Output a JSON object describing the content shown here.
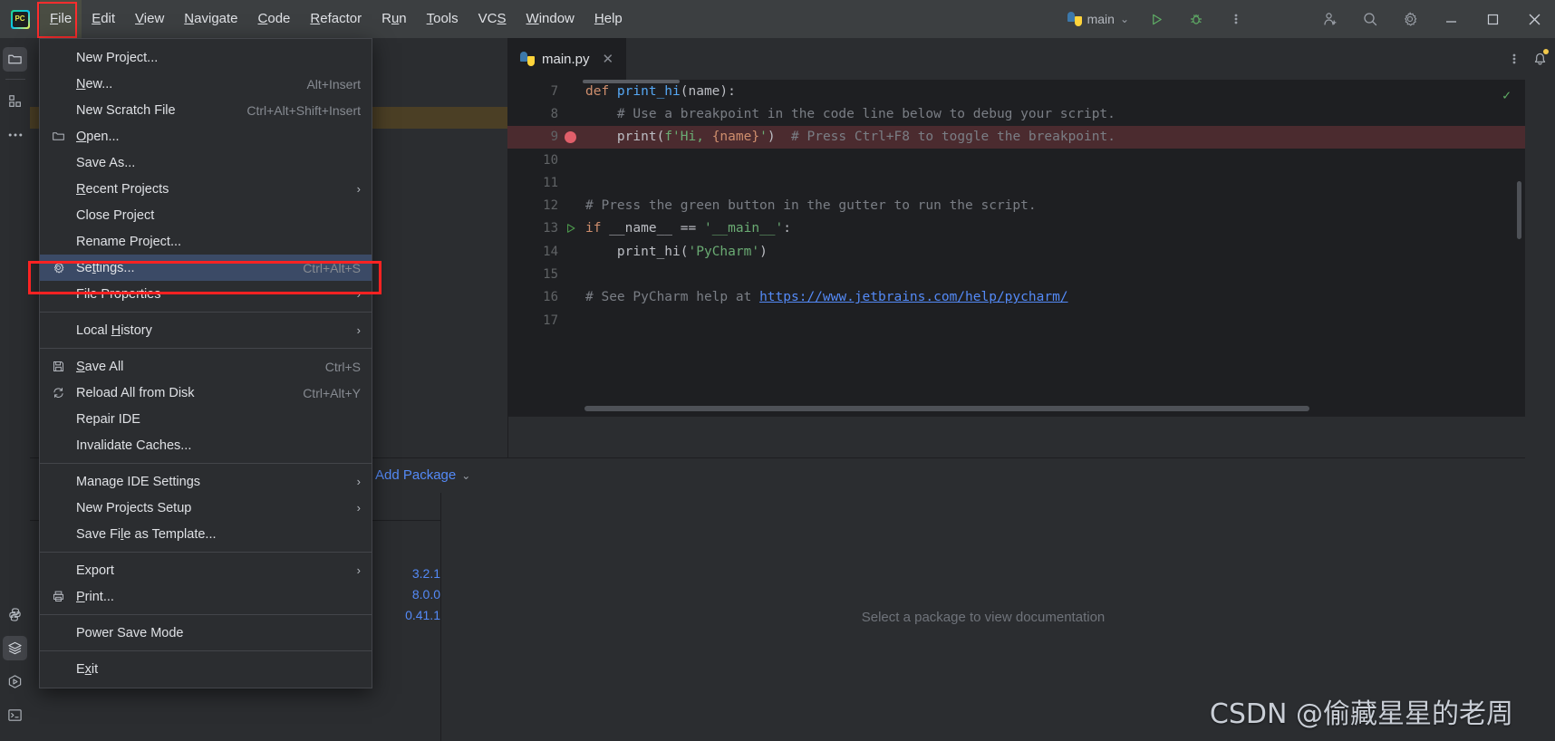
{
  "app": {
    "logo_text": "PC",
    "title": "PyCharm"
  },
  "menubar": {
    "items": [
      {
        "label": "File",
        "mnemonic": "F",
        "active": true
      },
      {
        "label": "Edit",
        "mnemonic": "E",
        "active": false
      },
      {
        "label": "View",
        "mnemonic": "V",
        "active": false
      },
      {
        "label": "Navigate",
        "mnemonic": "N",
        "active": false
      },
      {
        "label": "Code",
        "mnemonic": "C",
        "active": false
      },
      {
        "label": "Refactor",
        "mnemonic": "R",
        "active": false
      },
      {
        "label": "Run",
        "mnemonic": "u",
        "active": false
      },
      {
        "label": "Tools",
        "mnemonic": "T",
        "active": false
      },
      {
        "label": "VCS",
        "mnemonic": "S",
        "active": false
      },
      {
        "label": "Window",
        "mnemonic": "W",
        "active": false
      },
      {
        "label": "Help",
        "mnemonic": "H",
        "active": false
      }
    ]
  },
  "toolbar": {
    "run_config_label": "main",
    "run_icon": "run-triangle-icon",
    "debug_icon": "debug-bug-icon",
    "more_icon": "more-vertical-icon",
    "account_icon": "add-user-icon",
    "search_icon": "search-icon",
    "settings_icon": "gear-icon",
    "minimize_icon": "minimize-icon",
    "maximize_icon": "maximize-icon",
    "close_icon": "close-icon"
  },
  "left_strip": {
    "items": [
      {
        "name": "project-tool-window",
        "icon": "folder-icon",
        "selected": true
      },
      {
        "name": "structure-tool-window",
        "icon": "structure-icon",
        "selected": false
      },
      {
        "name": "more-tool-windows",
        "icon": "ellipsis-icon",
        "selected": false
      }
    ],
    "bottom_items": [
      {
        "name": "python-console",
        "icon": "python-icon",
        "selected": false
      },
      {
        "name": "python-packages",
        "icon": "layers-icon",
        "selected": true
      },
      {
        "name": "services",
        "icon": "services-play-icon",
        "selected": false
      },
      {
        "name": "terminal",
        "icon": "terminal-icon",
        "selected": false
      }
    ]
  },
  "right_strip": {
    "items": [
      {
        "name": "notifications",
        "icon": "bell-icon"
      }
    ]
  },
  "file_menu": {
    "groups": [
      [
        {
          "label": "New Project...",
          "shortcut": "",
          "icon": "",
          "submenu": false,
          "selected": false
        },
        {
          "label": "New...",
          "mnemonic": "N",
          "shortcut": "Alt+Insert",
          "icon": "",
          "submenu": false,
          "selected": false
        },
        {
          "label": "New Scratch File",
          "shortcut": "Ctrl+Alt+Shift+Insert",
          "icon": "",
          "submenu": false,
          "selected": false
        },
        {
          "label": "Open...",
          "mnemonic": "O",
          "shortcut": "",
          "icon": "folder-icon",
          "submenu": false,
          "selected": false
        },
        {
          "label": "Save As...",
          "shortcut": "",
          "icon": "",
          "submenu": false,
          "selected": false
        },
        {
          "label": "Recent Projects",
          "mnemonic": "R",
          "shortcut": "",
          "icon": "",
          "submenu": true,
          "selected": false
        },
        {
          "label": "Close Project",
          "shortcut": "",
          "icon": "",
          "submenu": false,
          "selected": false
        },
        {
          "label": "Rename Project...",
          "shortcut": "",
          "icon": "",
          "submenu": false,
          "selected": false
        },
        {
          "label": "Settings...",
          "mnemonic": "t",
          "shortcut": "Ctrl+Alt+S",
          "icon": "gear-icon",
          "submenu": false,
          "selected": true
        },
        {
          "label": "File Properties",
          "shortcut": "",
          "icon": "",
          "submenu": true,
          "selected": false
        }
      ],
      [
        {
          "label": "Local History",
          "mnemonic": "H",
          "shortcut": "",
          "icon": "",
          "submenu": true,
          "selected": false
        }
      ],
      [
        {
          "label": "Save All",
          "mnemonic": "S",
          "shortcut": "Ctrl+S",
          "icon": "save-disk-icon",
          "submenu": false,
          "selected": false
        },
        {
          "label": "Reload All from Disk",
          "shortcut": "Ctrl+Alt+Y",
          "icon": "refresh-icon",
          "submenu": false,
          "selected": false
        },
        {
          "label": "Repair IDE",
          "shortcut": "",
          "icon": "",
          "submenu": false,
          "selected": false
        },
        {
          "label": "Invalidate Caches...",
          "shortcut": "",
          "icon": "",
          "submenu": false,
          "selected": false
        }
      ],
      [
        {
          "label": "Manage IDE Settings",
          "shortcut": "",
          "icon": "",
          "submenu": true,
          "selected": false
        },
        {
          "label": "New Projects Setup",
          "shortcut": "",
          "icon": "",
          "submenu": true,
          "selected": false
        },
        {
          "label": "Save File as Template...",
          "mnemonic": "l",
          "shortcut": "",
          "icon": "",
          "submenu": false,
          "selected": false
        }
      ],
      [
        {
          "label": "Export",
          "shortcut": "",
          "icon": "",
          "submenu": true,
          "selected": false
        },
        {
          "label": "Print...",
          "mnemonic": "P",
          "shortcut": "",
          "icon": "printer-icon",
          "submenu": false,
          "selected": false
        }
      ],
      [
        {
          "label": "Power Save Mode",
          "shortcut": "",
          "icon": "",
          "submenu": false,
          "selected": false
        }
      ],
      [
        {
          "label": "Exit",
          "mnemonic": "x",
          "shortcut": "",
          "icon": "",
          "submenu": false,
          "selected": false
        }
      ]
    ]
  },
  "editor": {
    "tab_label": "main.py",
    "tab_icon": "python-file-icon",
    "tab_close_icon": "close-icon",
    "tab_more_icon": "more-vertical-icon",
    "inspection_icon": "checkmark-ok-icon",
    "lines": [
      {
        "num": "7",
        "gutter": "",
        "breakpoint": false,
        "tokens": [
          {
            "t": "def ",
            "c": "k"
          },
          {
            "t": "print_hi",
            "c": "fn"
          },
          {
            "t": "(name):",
            "c": "pl"
          }
        ]
      },
      {
        "num": "8",
        "gutter": "",
        "breakpoint": false,
        "tokens": [
          {
            "t": "    # Use a breakpoint in the code line below to debug your script.",
            "c": "cm"
          }
        ]
      },
      {
        "num": "9",
        "gutter": "breakpoint",
        "breakpoint": true,
        "tokens": [
          {
            "t": "    print(",
            "c": "pl"
          },
          {
            "t": "f'Hi, ",
            "c": "str"
          },
          {
            "t": "{name}",
            "c": "brace"
          },
          {
            "t": "'",
            "c": "str"
          },
          {
            "t": ")  ",
            "c": "pl"
          },
          {
            "t": "# Press Ctrl+F8 to toggle the breakpoint.",
            "c": "cm"
          }
        ]
      },
      {
        "num": "10",
        "gutter": "",
        "breakpoint": false,
        "tokens": []
      },
      {
        "num": "11",
        "gutter": "",
        "breakpoint": false,
        "tokens": []
      },
      {
        "num": "12",
        "gutter": "",
        "breakpoint": false,
        "tokens": [
          {
            "t": "# Press the green button in the gutter to run the script.",
            "c": "cm"
          }
        ]
      },
      {
        "num": "13",
        "gutter": "run",
        "breakpoint": false,
        "tokens": [
          {
            "t": "if ",
            "c": "k"
          },
          {
            "t": "__name__ == ",
            "c": "pl"
          },
          {
            "t": "'__main__'",
            "c": "str"
          },
          {
            "t": ":",
            "c": "pl"
          }
        ]
      },
      {
        "num": "14",
        "gutter": "",
        "breakpoint": false,
        "tokens": [
          {
            "t": "    print_hi(",
            "c": "pl"
          },
          {
            "t": "'PyCharm'",
            "c": "str"
          },
          {
            "t": ")",
            "c": "pl"
          }
        ]
      },
      {
        "num": "15",
        "gutter": "",
        "breakpoint": false,
        "tokens": []
      },
      {
        "num": "16",
        "gutter": "",
        "breakpoint": false,
        "tokens": [
          {
            "t": "# See PyCharm help at ",
            "c": "cm"
          },
          {
            "t": "https://www.jetbrains.com/help/pycharm/",
            "c": "link"
          }
        ]
      },
      {
        "num": "17",
        "gutter": "",
        "breakpoint": false,
        "tokens": []
      }
    ]
  },
  "packages_panel": {
    "add_package_label": "Add Package",
    "add_package_chevron": "chevron-down-icon",
    "versions": [
      "3.2.1",
      "8.0.0",
      "0.41.1"
    ],
    "doc_placeholder": "Select a package to view documentation"
  },
  "watermark": {
    "text": "CSDN @偷藏星星的老周"
  }
}
